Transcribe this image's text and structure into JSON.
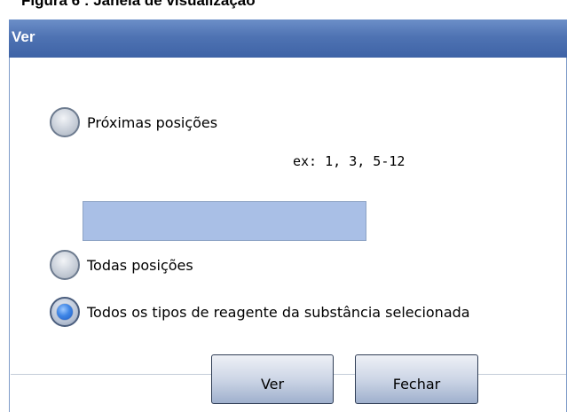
{
  "caption": {
    "text": "Figura 6 : Janela de visualização"
  },
  "dialog": {
    "title": "Ver",
    "options": [
      {
        "label": "Próximas posições",
        "checked": false
      },
      {
        "label": "Todas posições",
        "checked": false
      },
      {
        "label": "Todos os tipos de reagente da substância selecionada",
        "checked": true
      }
    ],
    "hint": "ex: 1, 3, 5-12",
    "positions_input": {
      "value": "",
      "placeholder": ""
    },
    "buttons": {
      "view_label": "Ver",
      "close_label": "Fechar"
    }
  },
  "colors": {
    "titlebar": "#4f73b3",
    "input_background": "#a9bfe6",
    "selected_radio": "#3f86e6"
  }
}
